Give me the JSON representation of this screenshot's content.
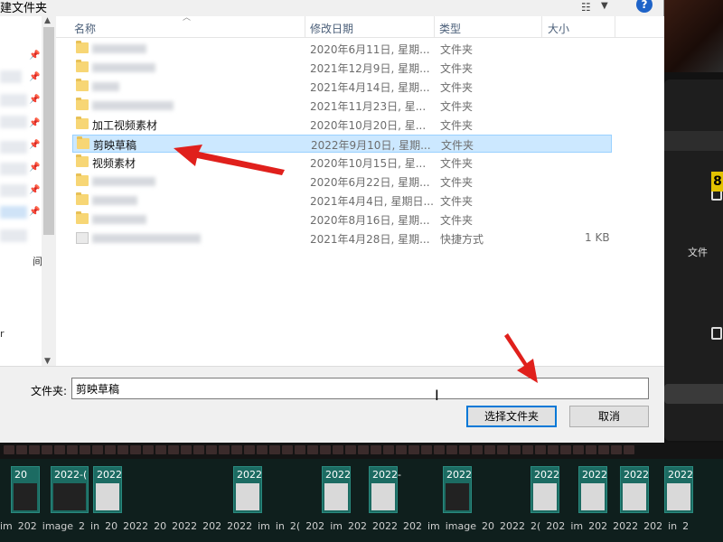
{
  "dialog": {
    "title": "建文件夹",
    "help_label": "?",
    "columns": {
      "name": "名称",
      "date": "修改日期",
      "type": "类型",
      "size": "大小"
    },
    "rows": [
      {
        "name": "",
        "date": "2020年6月11日, 星期...",
        "type": "文件夹",
        "size": "",
        "kind": "folder",
        "blurred": true
      },
      {
        "name": "",
        "date": "2021年12月9日, 星期...",
        "type": "文件夹",
        "size": "",
        "kind": "folder",
        "blurred": true
      },
      {
        "name": "",
        "date": "2021年4月14日, 星期...",
        "type": "文件夹",
        "size": "",
        "kind": "folder",
        "blurred": true
      },
      {
        "name": "",
        "date": "2021年11月23日, 星...",
        "type": "文件夹",
        "size": "",
        "kind": "folder",
        "blurred": true
      },
      {
        "name": "加工视频素材",
        "date": "2020年10月20日, 星...",
        "type": "文件夹",
        "size": "",
        "kind": "folder",
        "blurred": false
      },
      {
        "name": "剪映草稿",
        "date": "2022年9月10日, 星期...",
        "type": "文件夹",
        "size": "",
        "kind": "folder",
        "blurred": false,
        "selected": true
      },
      {
        "name": "视频素材",
        "date": "2020年10月15日, 星...",
        "type": "文件夹",
        "size": "",
        "kind": "folder",
        "blurred": false
      },
      {
        "name": "",
        "date": "2020年6月22日, 星期...",
        "type": "文件夹",
        "size": "",
        "kind": "folder",
        "blurred": true
      },
      {
        "name": "",
        "date": "2021年4月4日, 星期日...",
        "type": "文件夹",
        "size": "",
        "kind": "folder",
        "blurred": true
      },
      {
        "name": "",
        "date": "2020年8月16日, 星期...",
        "type": "文件夹",
        "size": "",
        "kind": "folder",
        "blurred": true
      },
      {
        "name": "",
        "date": "2021年4月28日, 星期...",
        "type": "快捷方式",
        "size": "1 KB",
        "kind": "shortcut",
        "blurred": true
      }
    ],
    "nav_chars": [
      "间",
      "r"
    ],
    "folder_label": "文件夹:",
    "folder_value": "剪映草稿",
    "select_button": "选择文件夹",
    "cancel_button": "取消"
  },
  "background": {
    "right_text": "文件",
    "badge": "8",
    "timeline_clip_labels": [
      "20",
      "2022-(",
      "2022",
      "2022",
      "2022",
      "2022-",
      "2022",
      "2022",
      "2022",
      "2022",
      "2022"
    ],
    "timeline_file_labels": [
      "im",
      "202",
      "image",
      "2",
      "in",
      "20",
      "2022",
      "20",
      "2022",
      "202",
      "2022",
      "im",
      "in",
      "2(",
      "202",
      "im",
      "202",
      "2022",
      "202",
      "im",
      "image",
      "20",
      "2022",
      "2(",
      "202",
      "im",
      "202",
      "2022",
      "202",
      "in",
      "2"
    ]
  },
  "colors": {
    "selection_bg": "#cce8ff",
    "selection_border": "#99d1ff",
    "primary_button_border": "#0078d7",
    "annotation_arrow": "#e0201c",
    "folder": "#f7d675",
    "help": "#1e63c8"
  }
}
